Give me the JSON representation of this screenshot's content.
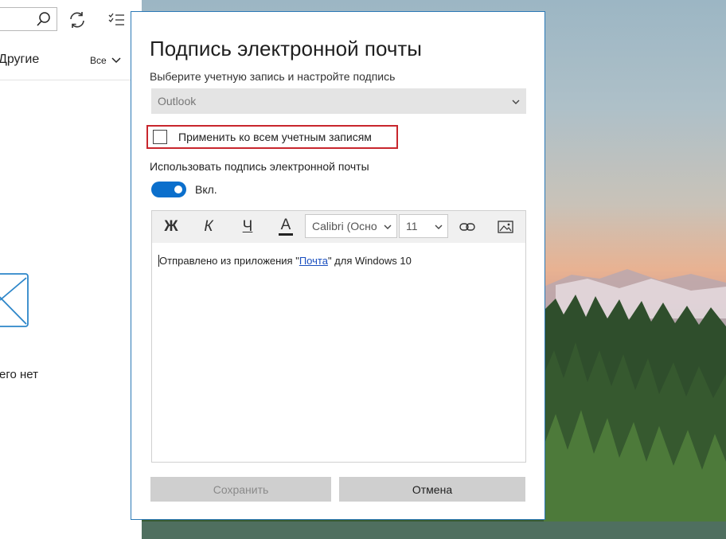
{
  "left_pane": {
    "folder_label": "Другие",
    "filter_label": "Все",
    "empty_message": "его нет"
  },
  "icons": {
    "search": "search-icon",
    "sync": "sync-icon",
    "select": "select-mode-icon",
    "filter": "chevron-down-icon",
    "empty": "envelope-icon"
  },
  "dialog": {
    "title": "Подпись электронной почты",
    "subtitle": "Выберите учетную запись и настройте подпись",
    "account_value": "Outlook",
    "apply_all_label": "Применить ко всем учетным записям",
    "apply_all_checked": false,
    "use_signature_label": "Использовать подпись электронной почты",
    "toggle_on": true,
    "toggle_label": "Вкл.",
    "toolbar": {
      "bold": "Ж",
      "italic": "К",
      "underline": "Ч",
      "font_color": "A",
      "font_name": "Calibri (Осно",
      "font_size": "11"
    },
    "signature": {
      "prefix": "Отправлено из приложения \"",
      "link": "Почта",
      "suffix": "\" для Windows 10"
    },
    "save_label": "Сохранить",
    "cancel_label": "Отмена"
  },
  "colors": {
    "accent": "#0b6fcc",
    "highlight_border": "#c8262d",
    "dialog_border": "#2b79b6"
  }
}
